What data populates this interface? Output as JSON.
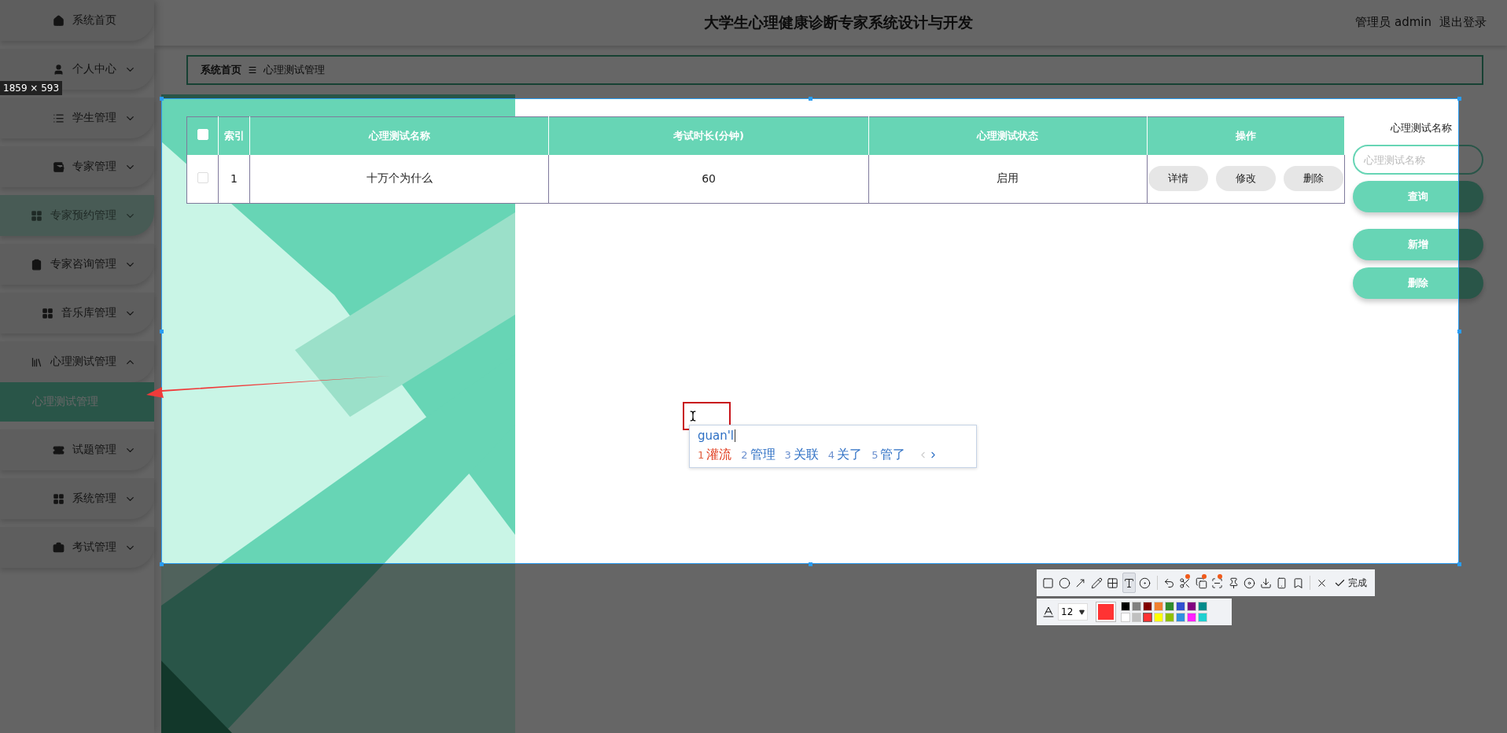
{
  "header": {
    "title": "大学生心理健康诊断专家系统设计与开发",
    "user": "管理员 admin",
    "logout": "退出登录"
  },
  "sidebar": {
    "items": [
      {
        "label": "系统首页",
        "kind": "link",
        "highlighted": false
      },
      {
        "label": "个人中心",
        "kind": "menu",
        "expanded": false,
        "highlighted": false
      },
      {
        "label": "学生管理",
        "kind": "menu",
        "expanded": false,
        "highlighted": false
      },
      {
        "label": "专家管理",
        "kind": "menu",
        "expanded": false,
        "highlighted": false
      },
      {
        "label": "专家预约管理",
        "kind": "menu",
        "expanded": false,
        "highlighted": true
      },
      {
        "label": "专家咨询管理",
        "kind": "menu",
        "expanded": false,
        "highlighted": false
      },
      {
        "label": "音乐库管理",
        "kind": "menu",
        "expanded": false,
        "highlighted": false
      },
      {
        "label": "心理测试管理",
        "kind": "menu",
        "expanded": true,
        "highlighted": false,
        "children": [
          {
            "label": "心理测试管理",
            "selected": true
          }
        ]
      },
      {
        "label": "试题管理",
        "kind": "menu",
        "expanded": false,
        "highlighted": false
      },
      {
        "label": "系统管理",
        "kind": "menu",
        "expanded": false,
        "highlighted": false
      },
      {
        "label": "考试管理",
        "kind": "menu",
        "expanded": false,
        "highlighted": false
      }
    ]
  },
  "breadcrumb": [
    "系统首页",
    "心理测试管理"
  ],
  "table": {
    "select_all_checked": false,
    "columns": [
      "索引",
      "心理测试名称",
      "考试时长(分钟)",
      "心理测试状态",
      "操作"
    ],
    "rows": [
      {
        "checked": false,
        "cells": [
          "1",
          "十万个为什么",
          "60",
          "启用"
        ],
        "actions": [
          "详情",
          "修改",
          "删除"
        ]
      }
    ]
  },
  "search": {
    "label": "心理测试名称",
    "placeholder": "心理测试名称",
    "button": "查询"
  },
  "actions": [
    "新增",
    "删除"
  ],
  "capture": {
    "size": "1859 × 593",
    "ime": {
      "input": "guan'l",
      "candidates": [
        {
          "number": "1",
          "text": "灌流",
          "selected": true
        },
        {
          "number": "2",
          "text": "管理",
          "selected": false
        },
        {
          "number": "3",
          "text": "关联",
          "selected": false
        },
        {
          "number": "4",
          "text": "关了",
          "selected": false
        },
        {
          "number": "5",
          "text": "管了",
          "selected": false
        }
      ]
    },
    "toolbar": {
      "tools": [
        {
          "kind": "rect",
          "selected": false,
          "badge": false
        },
        {
          "kind": "circle",
          "selected": false,
          "badge": false
        },
        {
          "kind": "arrow",
          "selected": false,
          "badge": false
        },
        {
          "kind": "pencil",
          "selected": false,
          "badge": false
        },
        {
          "kind": "mosaic",
          "selected": false,
          "badge": false
        },
        {
          "kind": "text",
          "selected": true,
          "badge": false
        },
        {
          "kind": "number",
          "selected": false,
          "badge": false
        },
        {
          "kind": "undo",
          "selected": false,
          "badge": false
        },
        {
          "kind": "scissors",
          "selected": false,
          "badge": true
        },
        {
          "kind": "copy",
          "selected": false,
          "badge": true
        },
        {
          "kind": "scan",
          "selected": false,
          "badge": true
        },
        {
          "kind": "pin",
          "selected": false,
          "badge": false
        },
        {
          "kind": "record",
          "selected": false,
          "badge": false
        },
        {
          "kind": "download",
          "selected": false,
          "badge": false
        },
        {
          "kind": "phone",
          "selected": false,
          "badge": false
        },
        {
          "kind": "bookmark",
          "selected": false,
          "badge": false
        },
        {
          "kind": "close",
          "selected": false,
          "badge": false
        }
      ],
      "done": "完成",
      "font_size": "12",
      "palette": [
        {
          "color": "#000000"
        },
        {
          "color": "#808080"
        },
        {
          "color": "#800000"
        },
        {
          "color": "#f08030"
        },
        {
          "color": "#2e8b2e"
        },
        {
          "color": "#3050d0"
        },
        {
          "color": "#800080"
        },
        {
          "color": "#008b8b"
        },
        {
          "color": "#ffffff"
        },
        {
          "color": "#c0c0c0"
        },
        {
          "color": "#ff3333",
          "selected": true
        },
        {
          "color": "#ffff00"
        },
        {
          "color": "#90c000"
        },
        {
          "color": "#3090e0"
        },
        {
          "color": "#ff20ff"
        },
        {
          "color": "#20d0d0"
        }
      ]
    }
  }
}
